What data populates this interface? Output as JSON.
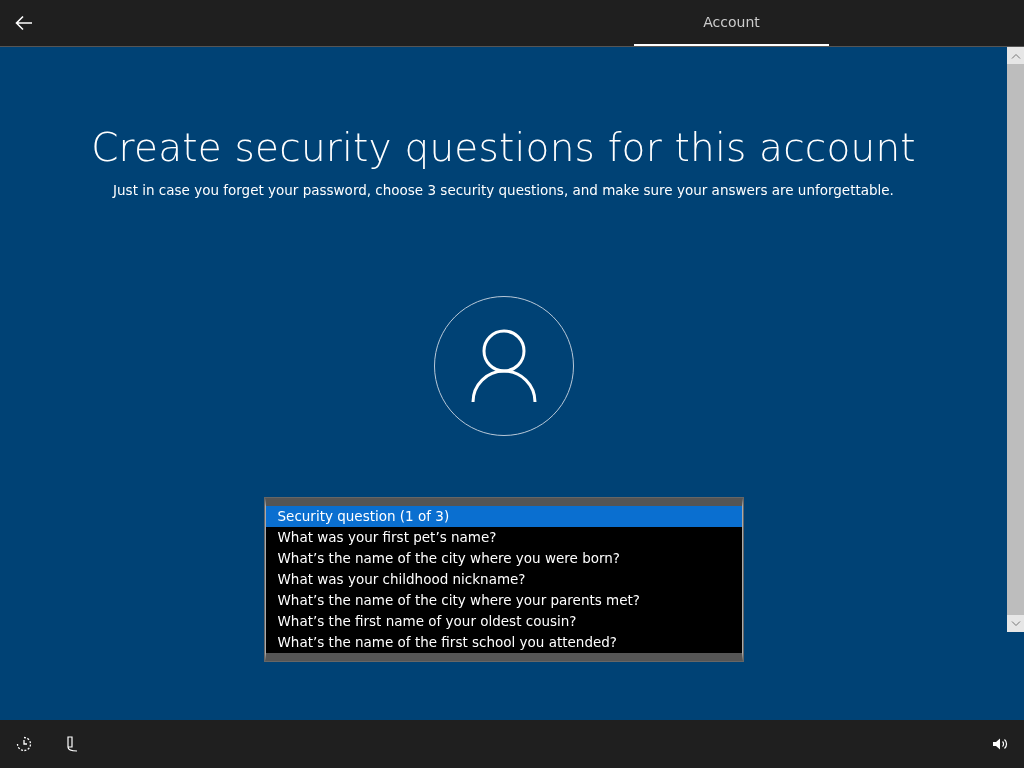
{
  "header": {
    "tabs": [
      {
        "label": "Account",
        "selected": true
      }
    ]
  },
  "title": "Create security questions for this account",
  "subtitle": "Just in case you forget your password, choose 3 security questions, and make sure your answers are unforgettable.",
  "dropdown": {
    "options": [
      {
        "label": "Security question (1 of 3)",
        "selected": true
      },
      {
        "label": "What was your first pet’s name?",
        "selected": false
      },
      {
        "label": "What’s the name of the city where you were born?",
        "selected": false
      },
      {
        "label": "What was your childhood nickname?",
        "selected": false
      },
      {
        "label": "What’s the name of the city where your parents met?",
        "selected": false
      },
      {
        "label": "What’s the first name of your oldest cousin?",
        "selected": false
      },
      {
        "label": "What’s the name of the first school you attended?",
        "selected": false
      }
    ]
  }
}
